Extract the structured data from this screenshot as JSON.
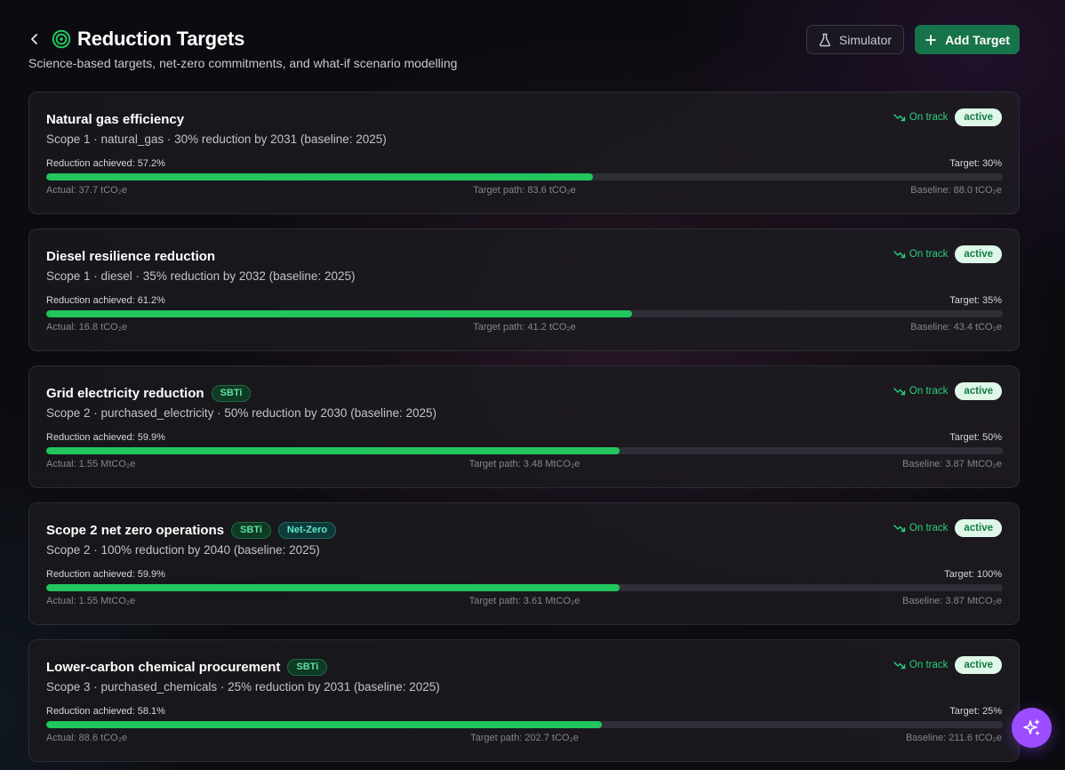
{
  "header": {
    "title": "Reduction Targets",
    "subtitle": "Science-based targets, net-zero commitments, and what-if scenario modelling",
    "simulator_label": "Simulator",
    "add_label": "Add Target"
  },
  "colors": {
    "accent": "#17734a",
    "progress": "#22c55e",
    "fab": "#9c4dff",
    "status": "#28d07a"
  },
  "icons": {
    "back": "chevron-left-icon",
    "title": "target-icon",
    "simulator": "flask-icon",
    "add": "plus-icon",
    "status": "trending-down-icon",
    "fab": "sparkles-icon"
  },
  "targets": [
    {
      "name": "Natural gas efficiency",
      "tags": [],
      "description": "Scope 1 · natural_gas · 30% reduction by 2031 (baseline: 2025)",
      "status": "On track",
      "badge": "active",
      "achieved": "Reduction achieved: 57.2%",
      "progress": 0.572,
      "target": "Target: 30%",
      "actual": "Actual: 37.7 tCO₂e",
      "target_path": "Target path: 83.6 tCO₂e",
      "baseline": "Baseline: 88.0 tCO₂e"
    },
    {
      "name": "Diesel resilience reduction",
      "tags": [],
      "description": "Scope 1 · diesel · 35% reduction by 2032 (baseline: 2025)",
      "status": "On track",
      "badge": "active",
      "achieved": "Reduction achieved: 61.2%",
      "progress": 0.612,
      "target": "Target: 35%",
      "actual": "Actual: 16.8 tCO₂e",
      "target_path": "Target path: 41.2 tCO₂e",
      "baseline": "Baseline: 43.4 tCO₂e"
    },
    {
      "name": "Grid electricity reduction",
      "tags": [
        {
          "label": "SBTi",
          "kind": "sbti"
        }
      ],
      "description": "Scope 2 · purchased_electricity · 50% reduction by 2030 (baseline: 2025)",
      "status": "On track",
      "badge": "active",
      "achieved": "Reduction achieved: 59.9%",
      "progress": 0.599,
      "target": "Target: 50%",
      "actual": "Actual: 1.55 MtCO₂e",
      "target_path": "Target path: 3.48 MtCO₂e",
      "baseline": "Baseline: 3.87 MtCO₂e"
    },
    {
      "name": "Scope 2 net zero operations",
      "tags": [
        {
          "label": "SBTi",
          "kind": "sbti"
        },
        {
          "label": "Net-Zero",
          "kind": "nz"
        }
      ],
      "description": "Scope 2 · 100% reduction by 2040 (baseline: 2025)",
      "status": "On track",
      "badge": "active",
      "achieved": "Reduction achieved: 59.9%",
      "progress": 0.599,
      "target": "Target: 100%",
      "actual": "Actual: 1.55 MtCO₂e",
      "target_path": "Target path: 3.61 MtCO₂e",
      "baseline": "Baseline: 3.87 MtCO₂e"
    },
    {
      "name": "Lower-carbon chemical procurement",
      "tags": [
        {
          "label": "SBTi",
          "kind": "sbti"
        }
      ],
      "description": "Scope 3 · purchased_chemicals · 25% reduction by 2031 (baseline: 2025)",
      "status": "On track",
      "badge": "active",
      "achieved": "Reduction achieved: 58.1%",
      "progress": 0.581,
      "target": "Target: 25%",
      "actual": "Actual: 88.6 tCO₂e",
      "target_path": "Target path: 202.7 tCO₂e",
      "baseline": "Baseline: 211.6 tCO₂e"
    }
  ]
}
